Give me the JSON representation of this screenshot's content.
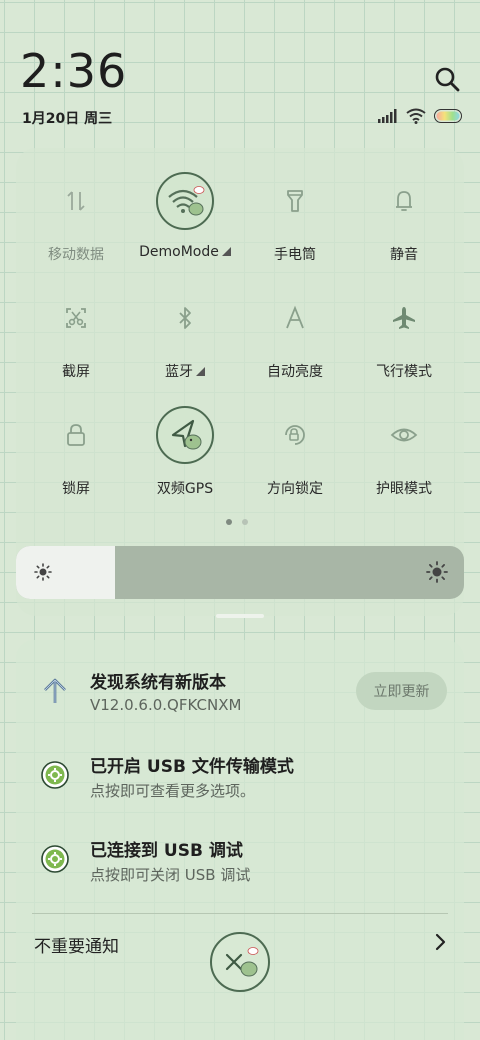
{
  "status": {
    "time": "2:36",
    "date": "1月20日 周三",
    "icons": [
      "signal-icon",
      "wifi-icon",
      "battery-icon"
    ]
  },
  "quick_tiles": [
    {
      "label": "移动数据",
      "icon": "mobile-data-icon",
      "state": "off"
    },
    {
      "label": "DemoMode",
      "icon": "wifi-icon",
      "state": "on",
      "has_menu": true
    },
    {
      "label": "手电筒",
      "icon": "flashlight-icon",
      "state": "off"
    },
    {
      "label": "静音",
      "icon": "bell-icon",
      "state": "off"
    },
    {
      "label": "截屏",
      "icon": "screenshot-icon",
      "state": "off"
    },
    {
      "label": "蓝牙",
      "icon": "bluetooth-icon",
      "state": "off",
      "has_menu": true
    },
    {
      "label": "自动亮度",
      "icon": "auto-brightness-icon",
      "state": "off"
    },
    {
      "label": "飞行模式",
      "icon": "airplane-icon",
      "state": "off"
    },
    {
      "label": "锁屏",
      "icon": "lock-icon",
      "state": "off"
    },
    {
      "label": "双频GPS",
      "icon": "gps-icon",
      "state": "on"
    },
    {
      "label": "方向锁定",
      "icon": "rotation-lock-icon",
      "state": "off"
    },
    {
      "label": "护眼模式",
      "icon": "eye-icon",
      "state": "off"
    }
  ],
  "page_indicator": {
    "current": 1,
    "total": 2
  },
  "brightness": {
    "level": 0.22
  },
  "notifications": [
    {
      "title": "发现系统有新版本",
      "subtitle": "V12.0.6.0.QFKCNXM",
      "icon": "arrow-up-icon",
      "action": "立即更新"
    },
    {
      "title": "已开启 USB 文件传输模式",
      "subtitle": "点按即可查看更多选项。",
      "icon": "android-settings-icon"
    },
    {
      "title": "已连接到 USB 调试",
      "subtitle": "点按即可关闭 USB 调试",
      "icon": "android-settings-icon"
    }
  ],
  "footer": {
    "unimportant_label": "不重要通知"
  },
  "colors": {
    "background": "#d9e8d5",
    "grid": "#bcd6c3",
    "accent": "#4d6b52"
  }
}
